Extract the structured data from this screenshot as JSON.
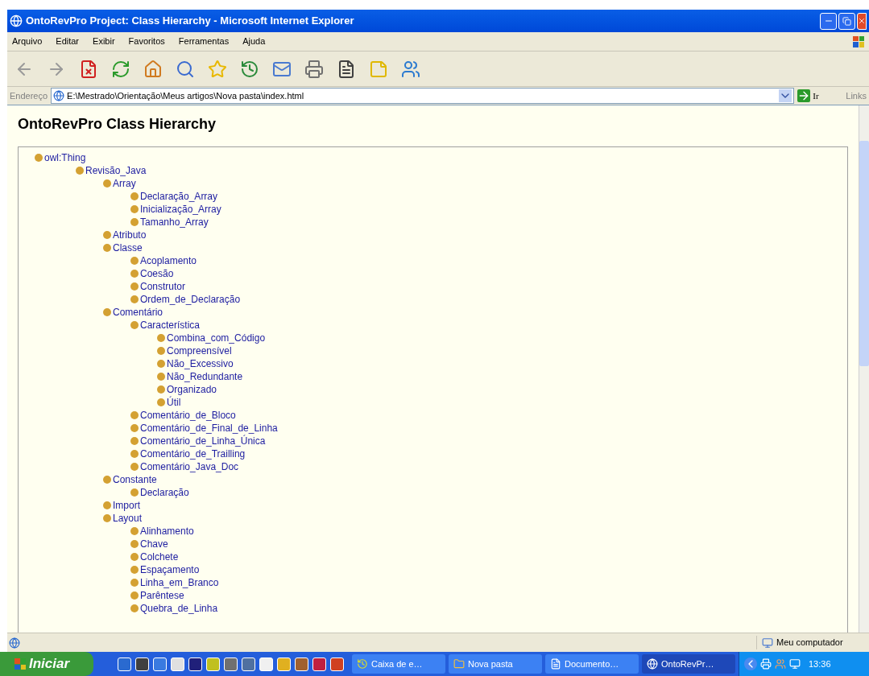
{
  "window": {
    "title": "OntoRevPro Project: Class Hierarchy - Microsoft Internet Explorer"
  },
  "menu": [
    "Arquivo",
    "Editar",
    "Exibir",
    "Favoritos",
    "Ferramentas",
    "Ajuda"
  ],
  "address_bar": {
    "label": "Endereço",
    "value": "E:\\Mestrado\\Orientação\\Meus artigos\\Nova pasta\\index.html",
    "go": "Ir",
    "links": "Links"
  },
  "page": {
    "heading": "OntoRevPro Class Hierarchy",
    "tree": [
      {
        "label": "owl:Thing",
        "children": [
          {
            "label": "Revisão_Java",
            "children": [
              {
                "label": "Array",
                "children": [
                  {
                    "label": "Declaração_Array"
                  },
                  {
                    "label": "Inicialização_Array"
                  },
                  {
                    "label": "Tamanho_Array"
                  }
                ]
              },
              {
                "label": "Atributo"
              },
              {
                "label": "Classe",
                "children": [
                  {
                    "label": "Acoplamento"
                  },
                  {
                    "label": "Coesão"
                  },
                  {
                    "label": "Construtor"
                  },
                  {
                    "label": "Ordem_de_Declaração"
                  }
                ]
              },
              {
                "label": "Comentário",
                "children": [
                  {
                    "label": "Característica",
                    "children": [
                      {
                        "label": "Combina_com_Código"
                      },
                      {
                        "label": "Compreensível"
                      },
                      {
                        "label": "Não_Excessivo"
                      },
                      {
                        "label": "Não_Redundante"
                      },
                      {
                        "label": "Organizado"
                      },
                      {
                        "label": "Útil"
                      }
                    ]
                  },
                  {
                    "label": "Comentário_de_Bloco"
                  },
                  {
                    "label": "Comentário_de_Final_de_Linha"
                  },
                  {
                    "label": "Comentário_de_Linha_Única"
                  },
                  {
                    "label": "Comentário_de_Trailling"
                  },
                  {
                    "label": "Comentário_Java_Doc"
                  }
                ]
              },
              {
                "label": "Constante",
                "children": [
                  {
                    "label": "Declaração"
                  }
                ]
              },
              {
                "label": "Import"
              },
              {
                "label": "Layout",
                "children": [
                  {
                    "label": "Alinhamento"
                  },
                  {
                    "label": "Chave"
                  },
                  {
                    "label": "Colchete"
                  },
                  {
                    "label": "Espaçamento"
                  },
                  {
                    "label": "Linha_em_Branco"
                  },
                  {
                    "label": "Parêntese"
                  },
                  {
                    "label": "Quebra_de_Linha"
                  }
                ]
              }
            ]
          }
        ]
      }
    ]
  },
  "status_bar": {
    "zone": "Meu computador"
  },
  "taskbar": {
    "start": "Iniciar",
    "tasks": [
      {
        "label": "Caixa de e…",
        "selected": false
      },
      {
        "label": "Nova pasta",
        "selected": false
      },
      {
        "label": "Documento…",
        "selected": false
      },
      {
        "label": "OntoRevPr…",
        "selected": true
      }
    ],
    "clock": "13:36"
  }
}
